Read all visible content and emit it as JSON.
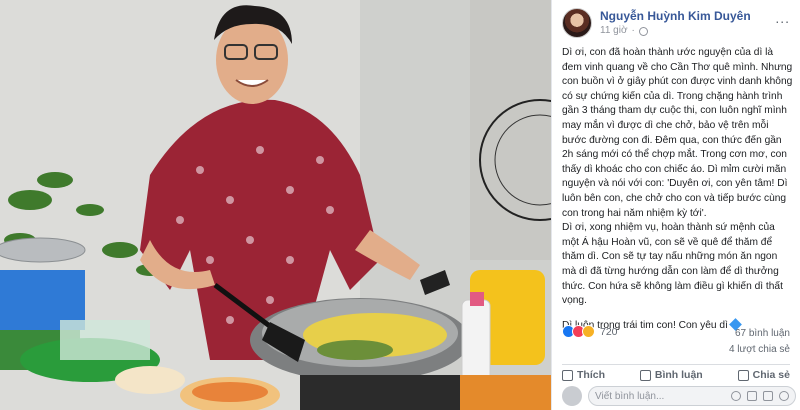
{
  "post": {
    "author": "Nguyễn Huỳnh Kim Duyên",
    "time": "11 giờ",
    "menu": "...",
    "paragraphs": [
      "Dì ơi, con đã hoàn thành ước nguyện của dì là đem vinh quang về cho Cần Thơ quê mình. Nhưng con buồn vì ở giây phút con được vinh danh không có sự chứng kiến của dì. Trong chặng hành trình gần 3 tháng tham dự cuộc thi, con luôn nghĩ mình may mắn vì được dì che chở, bảo vệ trên mỗi bước đường con đi. Đêm qua, con thức đến gần 2h sáng mới có thể chợp mắt. Trong cơn mơ, con thấy dì khoác cho con chiếc áo. Dì mỉm cười mãn nguyện và nói với con: 'Duyên ơi, con yên tâm! Dì luôn bên con, che chở cho con và tiếp bước cùng con trong hai năm nhiệm kỳ tới'.",
      "Dì ơi, xong nhiệm vụ, hoàn thành sứ mệnh của một Á hậu Hoàn vũ, con sẽ về quê để thăm để thăm dì. Con sẽ tự tay nấu những món ăn ngon mà dì đã từng hướng dẫn con làm để dì thưởng thức. Con hứa sẽ không làm điều gì khiến dì thất vọng.",
      "Dì luôn trong trái tim con! Con yêu dì"
    ],
    "closing_icon": "blue-heart-icon",
    "reaction_icons": [
      "like-icon",
      "love-icon",
      "sad-icon"
    ],
    "reaction_count": "720",
    "comments_count": "67 bình luận",
    "shares_count": "4 lượt chia sẻ",
    "actions": [
      "Thích",
      "Bình luận",
      "Chia sẻ"
    ],
    "comment_placeholder": "Viết bình luận..."
  },
  "colors": {
    "author": "#385898",
    "heart": "#3897f0",
    "like": "#1877f2",
    "love": "#f33e58",
    "sad": "#f7b125"
  }
}
